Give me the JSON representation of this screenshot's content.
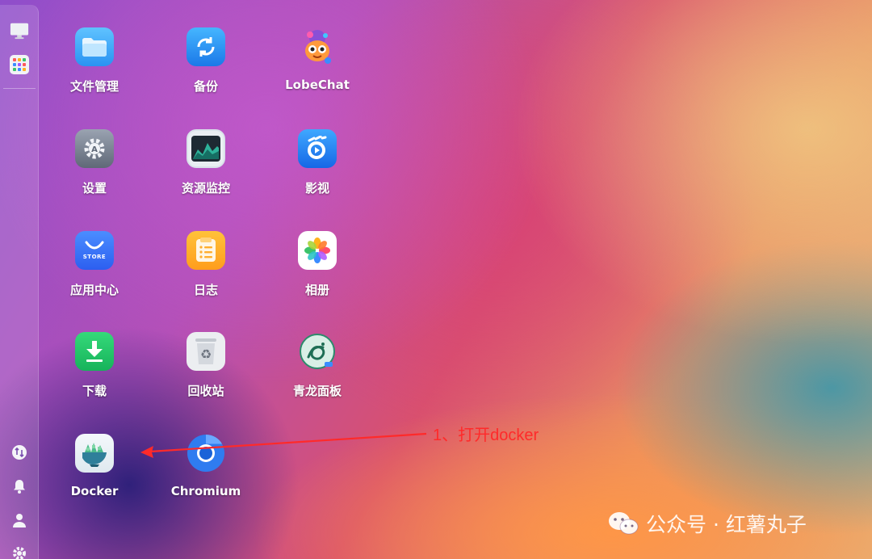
{
  "desktop": {
    "apps": [
      {
        "id": "file-manager",
        "label": "文件管理",
        "icon": "folder-icon"
      },
      {
        "id": "backup",
        "label": "备份",
        "icon": "sync-icon"
      },
      {
        "id": "lobechat",
        "label": "LobeChat",
        "icon": "lobe-mascot-icon"
      },
      {
        "id": "settings",
        "label": "设置",
        "icon": "gear-icon"
      },
      {
        "id": "resource-monitor",
        "label": "资源监控",
        "icon": "chart-icon"
      },
      {
        "id": "video",
        "label": "影视",
        "icon": "video-icon"
      },
      {
        "id": "app-center",
        "label": "应用中心",
        "icon": "store-icon",
        "badge": "STORE"
      },
      {
        "id": "log",
        "label": "日志",
        "icon": "log-icon"
      },
      {
        "id": "photos",
        "label": "相册",
        "icon": "flower-icon"
      },
      {
        "id": "download",
        "label": "下载",
        "icon": "download-icon"
      },
      {
        "id": "recycle-bin",
        "label": "回收站",
        "icon": "recycle-icon"
      },
      {
        "id": "qinglong",
        "label": "青龙面板",
        "icon": "dragon-icon"
      },
      {
        "id": "docker",
        "label": "Docker",
        "icon": "docker-icon"
      },
      {
        "id": "chromium",
        "label": "Chromium",
        "icon": "chromium-icon"
      }
    ]
  },
  "sidebar": {
    "top_icons": [
      "monitor-icon",
      "apps-grid-icon"
    ],
    "bottom_icons": [
      "sync-status-icon",
      "bell-icon",
      "user-icon",
      "settings-gear-icon"
    ]
  },
  "annotation": {
    "text": "1、打开docker",
    "color": "#ff2a2a"
  },
  "watermark": {
    "text": "公众号 · 红薯丸子",
    "icon": "wechat-icon"
  }
}
